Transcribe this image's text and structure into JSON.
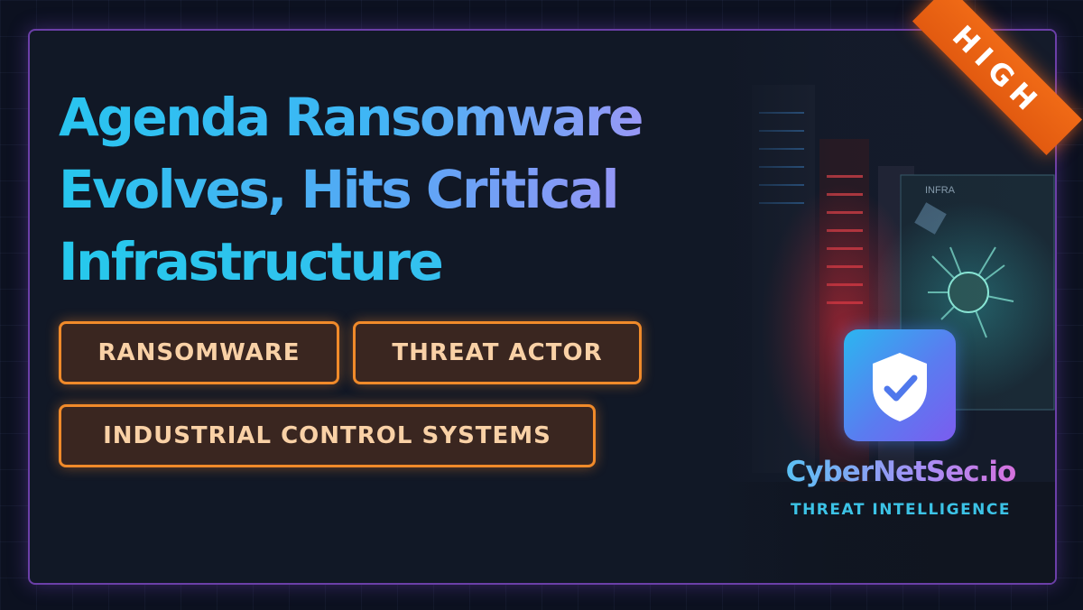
{
  "headline": {
    "line1": "Agenda Ransomware",
    "line2": "Evolves, Hits Critical",
    "line3": "Infrastructure"
  },
  "tags": [
    "RANSOMWARE",
    "THREAT ACTOR",
    "INDUSTRIAL CONTROL SYSTEMS"
  ],
  "severity": "HIGH",
  "brand": {
    "name": "CyberNetSec.io",
    "tagline": "THREAT INTELLIGENCE"
  },
  "scene": {
    "screen_label": "INFRA"
  },
  "colors": {
    "accent_cyan": "#29c4ef",
    "accent_purple": "#b98cf6",
    "tag_border": "#f08a2a",
    "severity_ribbon": "#f06a16",
    "frame_border": "#6b3fa8"
  }
}
